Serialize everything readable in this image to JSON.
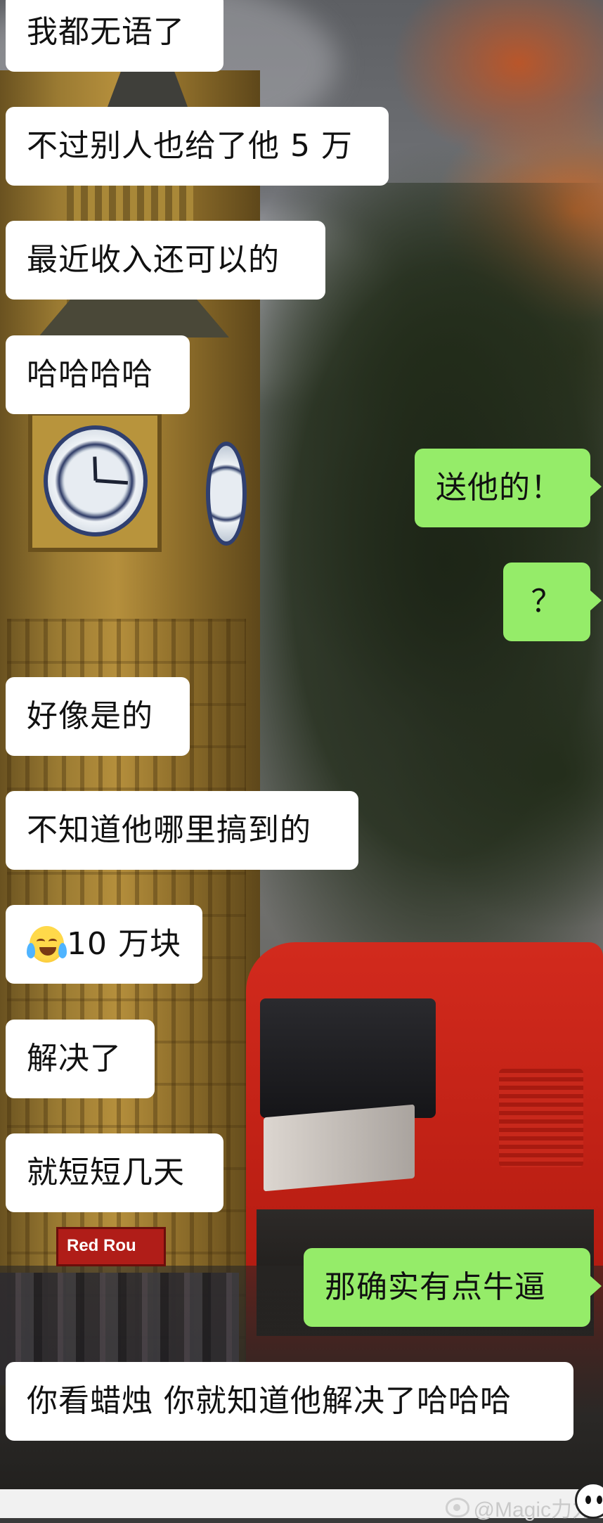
{
  "chat": {
    "messages": [
      {
        "side": "left",
        "text": "我都无语了"
      },
      {
        "side": "left",
        "text": "不过别人也给了他 5 万"
      },
      {
        "side": "left",
        "text": "最近收入还可以的"
      },
      {
        "side": "left",
        "text": "哈哈哈哈"
      },
      {
        "side": "right",
        "text": "送他的！"
      },
      {
        "side": "right",
        "text": "？"
      },
      {
        "side": "left",
        "text": "好像是的"
      },
      {
        "side": "left",
        "text": "不知道他哪里搞到的"
      },
      {
        "side": "left",
        "emoji": "crying-laughing-emoji",
        "text": "10 万块"
      },
      {
        "side": "left",
        "text": "解决了"
      },
      {
        "side": "left",
        "text": "就短短几天"
      },
      {
        "side": "right",
        "text": "那确实有点牛逼"
      },
      {
        "side": "left",
        "text": "你看蜡烛 你就知道他解决了哈哈哈"
      }
    ]
  },
  "wallpaper": {
    "scene": "Big Ben clock tower, autumn trees and red double-decker bus",
    "bus_sign": "Red Rou"
  },
  "watermark": {
    "text": "@Magic力力",
    "icon": "weibo-logo-icon"
  },
  "colors": {
    "incoming_bubble": "#ffffff",
    "outgoing_bubble": "#95ec69",
    "bus_red": "#d22a1d"
  }
}
